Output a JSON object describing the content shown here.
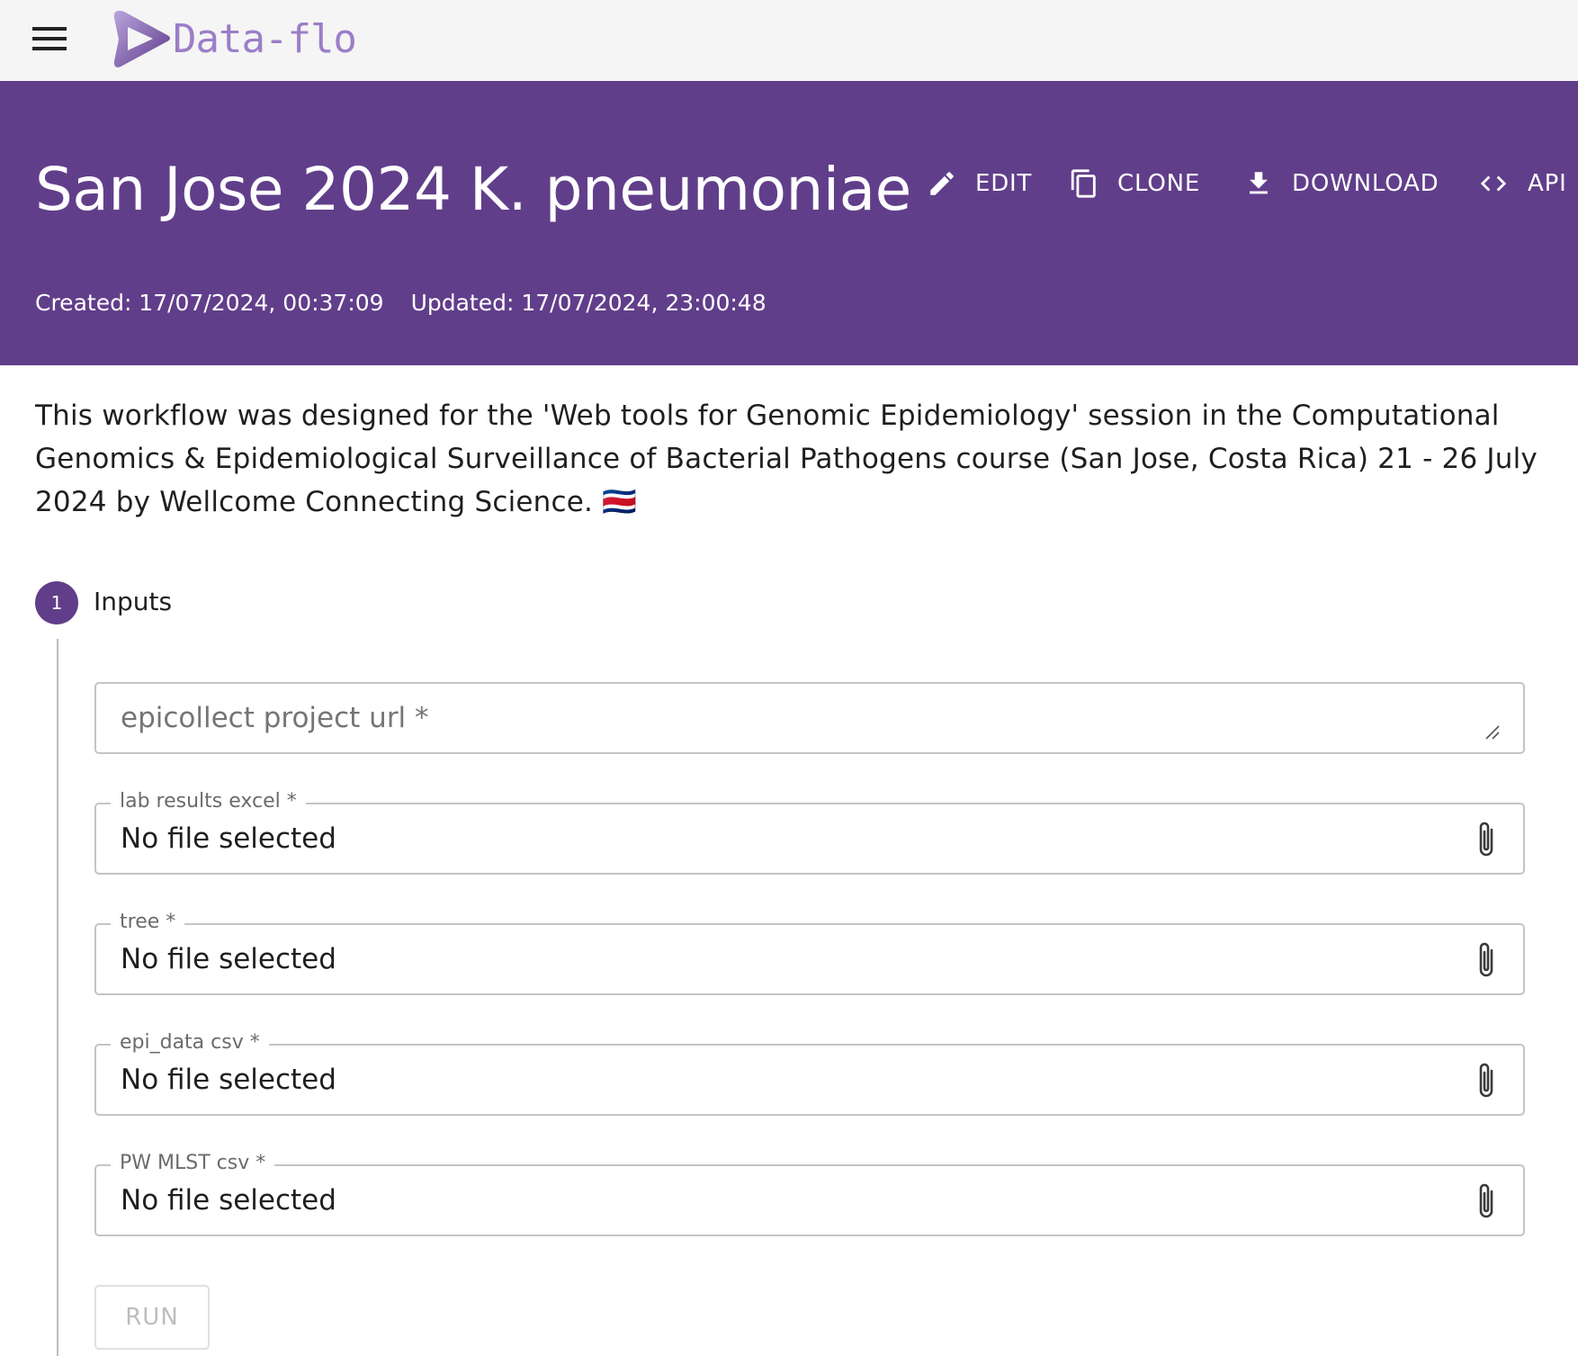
{
  "app": {
    "name": "Data-flo"
  },
  "workflow": {
    "title": "San Jose 2024 K. pneumoniae",
    "created": "Created: 17/07/2024, 00:37:09",
    "updated": "Updated: 17/07/2024, 23:00:48",
    "description": "This workflow was designed for the 'Web tools for Genomic Epidemiology' session in the Computational Genomics & Epidemiological Surveillance of Bacterial Pathogens course (San Jose, Costa Rica) 21 - 26 July 2024 by Wellcome Connecting Science. 🇨🇷"
  },
  "actions": {
    "edit": "EDIT",
    "clone": "CLONE",
    "download": "DOWNLOAD",
    "api": "API"
  },
  "step": {
    "number": "1",
    "label": "Inputs"
  },
  "inputs": {
    "url_placeholder": "epicollect project url *",
    "files": [
      {
        "label": "lab results excel *",
        "value": "No file selected"
      },
      {
        "label": "tree *",
        "value": "No file selected"
      },
      {
        "label": "epi_data csv *",
        "value": "No file selected"
      },
      {
        "label": "PW MLST csv *",
        "value": "No file selected"
      }
    ]
  },
  "run_label": "RUN",
  "colors": {
    "header": "#613e8a",
    "logo": "#9b7ec8",
    "topbar": "#f5f5f5"
  }
}
